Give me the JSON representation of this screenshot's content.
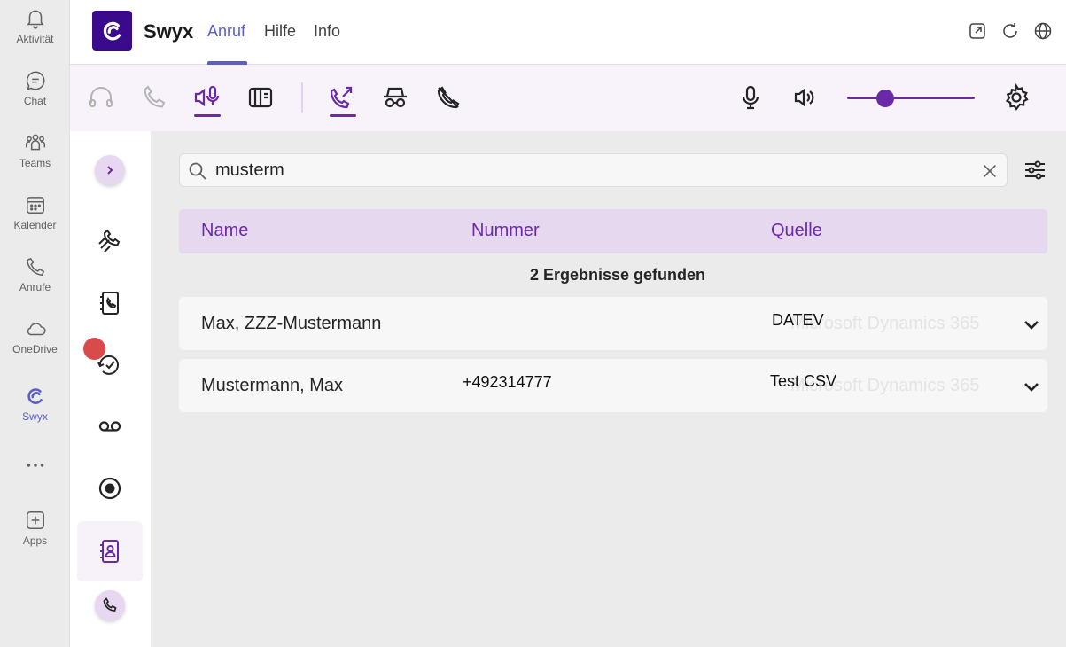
{
  "rail": {
    "items": [
      {
        "label": "Aktivität",
        "icon": "bell-icon"
      },
      {
        "label": "Chat",
        "icon": "chat-icon"
      },
      {
        "label": "Teams",
        "icon": "teams-icon"
      },
      {
        "label": "Kalender",
        "icon": "calendar-icon"
      },
      {
        "label": "Anrufe",
        "icon": "phone-icon"
      },
      {
        "label": "OneDrive",
        "icon": "cloud-icon"
      },
      {
        "label": "Swyx",
        "icon": "swyx-icon"
      },
      {
        "label": "Apps",
        "icon": "plus-square-icon"
      }
    ]
  },
  "header": {
    "title": "Swyx",
    "tabs": [
      {
        "label": "Anruf",
        "active": true
      },
      {
        "label": "Hilfe",
        "active": false
      },
      {
        "label": "Info",
        "active": false
      }
    ]
  },
  "search": {
    "value": "musterm"
  },
  "table": {
    "columns": [
      "Name",
      "Nummer",
      "Quelle"
    ],
    "result_count": "2 Ergebnisse gefunden",
    "rows": [
      {
        "name": "Max, ZZZ-Mustermann",
        "number": "",
        "source": "DATEV",
        "ghost": "Microsoft Dynamics 365"
      },
      {
        "name": "Mustermann, Max",
        "number": "+492314777",
        "source": "Test CSV",
        "ghost": "Microsoft Dynamics 365"
      }
    ]
  },
  "volume": {
    "level": 0.3
  },
  "colors": {
    "accent": "#6a2aa8",
    "teams_accent": "#5b5fc7",
    "logo": "#3a0a8c"
  }
}
